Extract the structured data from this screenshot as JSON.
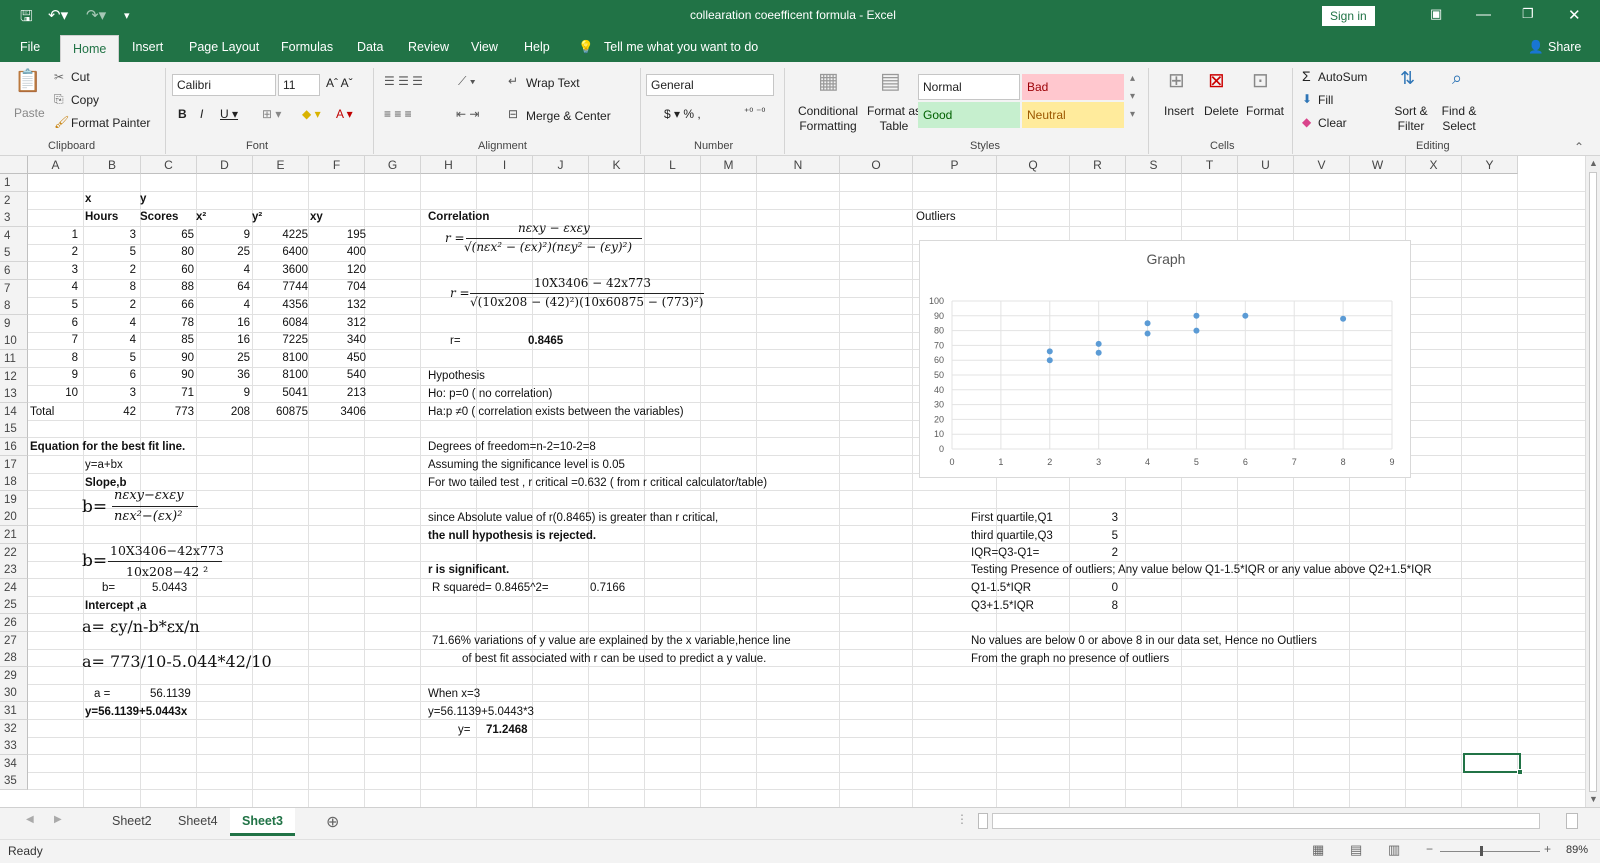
{
  "app": {
    "title": "collearation coeefficent formula  -  Excel",
    "sign_in": "Sign in"
  },
  "tabs": [
    "File",
    "Home",
    "Insert",
    "Page Layout",
    "Formulas",
    "Data",
    "Review",
    "View",
    "Help"
  ],
  "tell_me": "Tell me what you want to do",
  "share": "Share",
  "ribbon": {
    "paste": "Paste",
    "cut": "Cut",
    "copy": "Copy",
    "format_painter": "Format Painter",
    "clipboard": "Clipboard",
    "font_name": "Calibri",
    "font_size": "11",
    "font_group": "Font",
    "wrap_text": "Wrap Text",
    "merge_center": "Merge & Center",
    "alignment": "Alignment",
    "number_format": "General",
    "number": "Number",
    "conditional_formatting": "Conditional Formatting",
    "format_as_table": "Format as Table",
    "style_normal": "Normal",
    "style_bad": "Bad",
    "style_good": "Good",
    "style_neutral": "Neutral",
    "styles": "Styles",
    "insert": "Insert",
    "delete": "Delete",
    "format": "Format",
    "cells": "Cells",
    "autosum": "AutoSum",
    "fill": "Fill",
    "clear": "Clear",
    "sort_filter": "Sort & Filter",
    "find_select": "Find & Select",
    "editing": "Editing"
  },
  "columns": [
    "A",
    "B",
    "C",
    "D",
    "E",
    "F",
    "G",
    "H",
    "I",
    "J",
    "K",
    "L",
    "M",
    "N",
    "O",
    "P",
    "Q",
    "R",
    "S",
    "T",
    "U",
    "V",
    "W",
    "X",
    "Y"
  ],
  "rows": [
    "1",
    "2",
    "3",
    "4",
    "5",
    "6",
    "7",
    "8",
    "9",
    "10",
    "11",
    "12",
    "13",
    "14",
    "15",
    "16",
    "17",
    "18",
    "19",
    "20",
    "21",
    "22",
    "23",
    "24",
    "25",
    "26",
    "27",
    "28",
    "29",
    "30",
    "31",
    "32",
    "33",
    "34",
    "35"
  ],
  "table": {
    "x_label": "x",
    "y_label": "y",
    "headers": [
      "Hours",
      "Scores",
      "x²",
      "y²",
      "xy"
    ],
    "idx": [
      "1",
      "2",
      "3",
      "4",
      "5",
      "6",
      "7",
      "8",
      "9",
      "10"
    ],
    "hours": [
      "3",
      "5",
      "2",
      "8",
      "2",
      "4",
      "4",
      "5",
      "6",
      "3"
    ],
    "scores": [
      "65",
      "80",
      "60",
      "88",
      "66",
      "78",
      "85",
      "90",
      "90",
      "71"
    ],
    "x2": [
      "9",
      "25",
      "4",
      "64",
      "4",
      "16",
      "16",
      "25",
      "36",
      "9"
    ],
    "y2": [
      "4225",
      "6400",
      "3600",
      "7744",
      "4356",
      "6084",
      "7225",
      "8100",
      "8100",
      "5041"
    ],
    "xy": [
      "195",
      "400",
      "120",
      "704",
      "132",
      "312",
      "340",
      "450",
      "540",
      "213"
    ],
    "total_label": "Total",
    "totals": [
      "42",
      "773",
      "208",
      "60875",
      "3406"
    ]
  },
  "left": {
    "eq_title": "Equation for the best fit line.",
    "yabx": "y=a+bx",
    "slope": "Slope,b",
    "b_eq": "b=",
    "b_num": "nεxy−εxεy",
    "b_den": "nεx²−(εx)²",
    "b_num2": "10X3406−42x773",
    "b_den2": "10x208−42 ²",
    "b_label": "b=",
    "b_value": "5.0443",
    "intercept": "Intercept ,a",
    "a_formula": "a= εy/n-b*εx/n",
    "a_formula2": "a= 773/10-5.044*42/10",
    "a_label": "a =",
    "a_value": "56.1139",
    "final": "y=56.1139+5.0443x"
  },
  "middle": {
    "correlation": "Correlation",
    "r_eq1": "r =",
    "r_num1": "nεxy − εxεy",
    "r_den1": "√(nεx² − (εx)²)(nεy² − (εy)²)",
    "r_eq2": "r =",
    "r_num2": "10X3406 − 42x773",
    "r_den2": "√(10x208 − (42)²)(10x60875 − (773)²)",
    "r_label": "r=",
    "r_value": "0.8465",
    "hypothesis": "Hypothesis",
    "h0": "Ho: p=0   ( no correlation)",
    "ha": "Ha:p ≠0    ( correlation exists between the variables)",
    "dof": "Degrees of freedom=n-2=10-2=8",
    "sig": "Assuming the significance level is 0.05",
    "two_tailed": "For two tailed test , r critical =0.632   ( from r critical calculator/table)",
    "since": "since Absolute value of r(0.8465) is greater than r critical,",
    "rejected": "the null hypothesis is rejected.",
    "significant": "r is significant.",
    "rsq": "R squared= 0.8465^2=",
    "rsq_value": "0.7166",
    "explain1": "71.66% variations of y value are explained by the x variable,hence line",
    "explain2": "of best fit associated with r can be used to predict a y value.",
    "when": "When x=3",
    "pred": "y=56.1139+5.0443*3",
    "y_label": "y=",
    "y_value": "71.2468"
  },
  "right": {
    "outliers": "Outliers",
    "q1_label": "First quartile,Q1",
    "q1": "3",
    "q3_label": "third quartile,Q3",
    "q3": "5",
    "iqr_label": "IQR=Q3-Q1=",
    "iqr": "2",
    "testing": "Testing Presence of outliers; Any value below Q1-1.5*IQR or any value above Q2+1.5*IQR",
    "low_label": "Q1-1.5*IQR",
    "low": "0",
    "high_label": "Q3+1.5*IQR",
    "high": "8",
    "conclusion1": "No values are below 0 or above 8 in our data set, Hence no Outliers",
    "conclusion2": "From the graph no presence of outliers"
  },
  "chart_data": {
    "type": "scatter",
    "title": "Graph",
    "x": [
      3,
      5,
      2,
      8,
      2,
      4,
      4,
      5,
      6,
      3
    ],
    "y": [
      65,
      80,
      60,
      88,
      66,
      78,
      85,
      90,
      90,
      71
    ],
    "xlim": [
      0,
      9
    ],
    "ylim": [
      0,
      100
    ],
    "xticks": [
      "0",
      "1",
      "2",
      "3",
      "4",
      "5",
      "6",
      "7",
      "8",
      "9"
    ],
    "yticks": [
      "0",
      "10",
      "20",
      "30",
      "40",
      "50",
      "60",
      "70",
      "80",
      "90",
      "100"
    ],
    "color": "#5b9bd5",
    "grid": true
  },
  "sheets": [
    "Sheet2",
    "Sheet4",
    "Sheet3"
  ],
  "active_sheet": "Sheet3",
  "status": "Ready",
  "zoom": "89%",
  "colors": {
    "accent": "#217346",
    "bad_bg": "#ffc7ce",
    "good_bg": "#c6efce",
    "neutral_bg": "#ffeb9c"
  }
}
